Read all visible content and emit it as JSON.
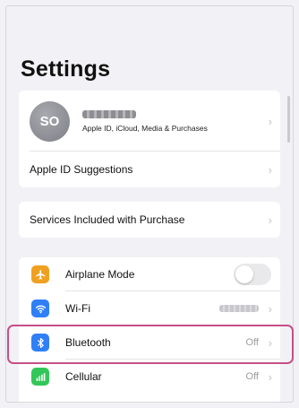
{
  "header": {
    "title": "Settings"
  },
  "account": {
    "avatar_initials": "SO",
    "subtitle": "Apple ID, iCloud, Media & Purchases"
  },
  "suggestions": {
    "label": "Apple ID Suggestions"
  },
  "services": {
    "label": "Services Included with Purchase"
  },
  "connectivity": {
    "airplane": {
      "label": "Airplane Mode",
      "icon": "airplane-icon",
      "color": "#f0a020",
      "toggle_on": false
    },
    "wifi": {
      "label": "Wi-Fi",
      "icon": "wifi-icon",
      "color": "#2f7ff6"
    },
    "bluetooth": {
      "label": "Bluetooth",
      "icon": "bluetooth-icon",
      "color": "#2f7ff6",
      "value": "Off"
    },
    "cellular": {
      "label": "Cellular",
      "icon": "cellular-icon",
      "color": "#33c759",
      "value": "Off"
    }
  },
  "highlight_color": "#c64f86"
}
